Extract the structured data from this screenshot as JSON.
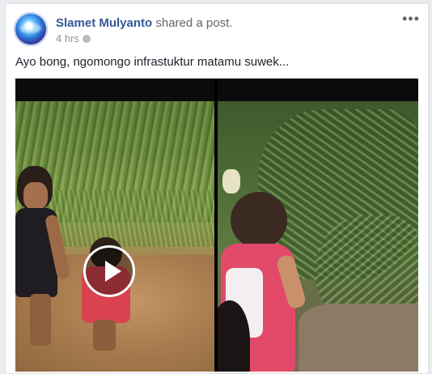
{
  "post": {
    "author": "Slamet Mulyanto",
    "action": "shared a post.",
    "time": "4 hrs",
    "message": "Ayo bong, ngomongo infrastuktur matamu suwek..."
  },
  "icons": {
    "more": "more-options-icon",
    "play": "play-icon",
    "privacy": "globe-icon"
  },
  "colors": {
    "author_link": "#365899",
    "background": "#e9ebee",
    "card": "#ffffff"
  }
}
